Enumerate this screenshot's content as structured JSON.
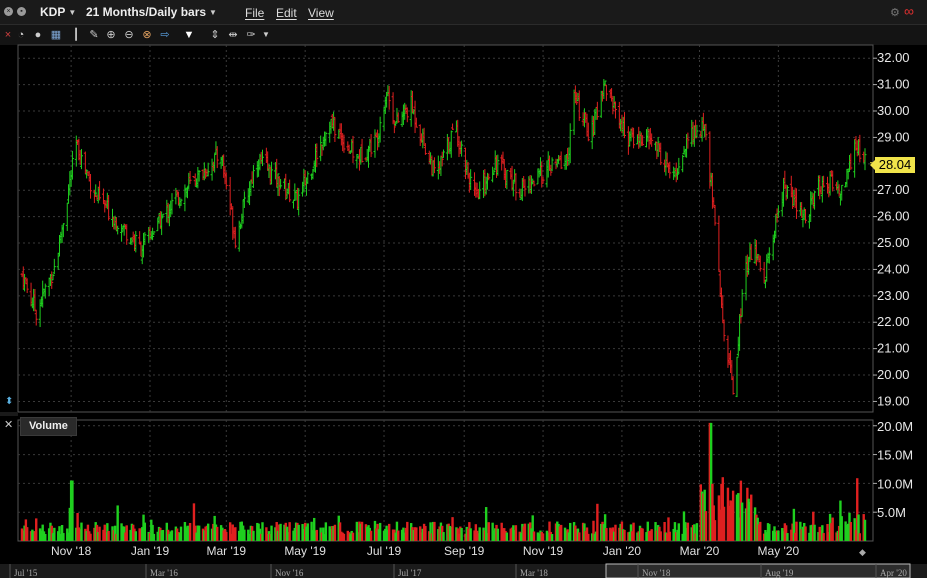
{
  "window": {
    "symbol": "KDP",
    "period": "21 Months/Daily bars",
    "menus": [
      "File",
      "Edit",
      "View"
    ]
  },
  "toolbar": {
    "tools": [
      "close-icon",
      "clock-icon",
      "circle-icon",
      "grid-icon",
      "bars-icon",
      "draw-icon",
      "zoom-in-icon",
      "zoom-out-icon",
      "crosshair-icon",
      "arrow-icon",
      "triangle-down-icon",
      "move-icon",
      "split-icon",
      "wrench-icon",
      "dropdown-icon"
    ]
  },
  "price_axis": {
    "labels": [
      "32.00",
      "31.00",
      "30.00",
      "29.00",
      "28.00",
      "27.00",
      "26.00",
      "25.00",
      "24.00",
      "23.00",
      "22.00",
      "21.00",
      "20.00",
      "19.00"
    ],
    "last_price": "28.04"
  },
  "volume_panel": {
    "title": "Volume",
    "labels": [
      "20.0M",
      "15.0M",
      "10.0M",
      "5.0M"
    ]
  },
  "time_axis": {
    "labels": [
      "Nov '18",
      "Jan '19",
      "Mar '19",
      "May '19",
      "Jul '19",
      "Sep '19",
      "Nov '19",
      "Jan '20",
      "Mar '20",
      "May '20"
    ]
  },
  "overview_axis": {
    "labels": [
      "Jul '15",
      "Mar '16",
      "Nov '16",
      "Jul '17",
      "Mar '18",
      "Nov '18",
      "Aug '19",
      "Apr '20"
    ]
  },
  "colors": {
    "up": "#1fd01f",
    "down": "#e02020",
    "grid": "#3a3a3a",
    "price_tag": "#f0e44a"
  },
  "chart_data": {
    "type": "candlestick",
    "y_range": [
      18.6,
      32.5
    ],
    "volume_range": [
      0,
      21
    ],
    "x_start": "2018-09-24",
    "x_end": "2020-07-07",
    "last_price": 28.04,
    "key_points": [
      {
        "date": "2018-09-24",
        "close": 23.8
      },
      {
        "date": "2018-10-05",
        "close": 22.4
      },
      {
        "date": "2018-10-20",
        "close": 24.2
      },
      {
        "date": "2018-11-05",
        "close": 28.7
      },
      {
        "date": "2018-11-20",
        "close": 26.8
      },
      {
        "date": "2018-12-25",
        "close": 24.8
      },
      {
        "date": "2019-01-20",
        "close": 26.6
      },
      {
        "date": "2019-02-25",
        "close": 28.4
      },
      {
        "date": "2019-03-08",
        "close": 25.2
      },
      {
        "date": "2019-03-25",
        "close": 28.2
      },
      {
        "date": "2019-04-25",
        "close": 26.6
      },
      {
        "date": "2019-05-20",
        "close": 29.6
      },
      {
        "date": "2019-06-10",
        "close": 28.2
      },
      {
        "date": "2019-06-25",
        "close": 28.9
      },
      {
        "date": "2019-07-03",
        "close": 30.8
      },
      {
        "date": "2019-07-10",
        "close": 29.5
      },
      {
        "date": "2019-07-22",
        "close": 30.2
      },
      {
        "date": "2019-08-10",
        "close": 27.5
      },
      {
        "date": "2019-08-25",
        "close": 29.4
      },
      {
        "date": "2019-09-10",
        "close": 26.6
      },
      {
        "date": "2019-09-25",
        "close": 28.1
      },
      {
        "date": "2019-10-15",
        "close": 27.0
      },
      {
        "date": "2019-11-05",
        "close": 27.8
      },
      {
        "date": "2019-11-20",
        "close": 28.2
      },
      {
        "date": "2019-11-25",
        "close": 30.5
      },
      {
        "date": "2019-12-08",
        "close": 29.0
      },
      {
        "date": "2019-12-18",
        "close": 31.1
      },
      {
        "date": "2020-01-05",
        "close": 29.0
      },
      {
        "date": "2020-01-25",
        "close": 28.9
      },
      {
        "date": "2020-02-10",
        "close": 27.4
      },
      {
        "date": "2020-02-22",
        "close": 29.1
      },
      {
        "date": "2020-03-05",
        "close": 29.3
      },
      {
        "date": "2020-03-10",
        "close": 27.2
      },
      {
        "date": "2020-03-20",
        "close": 21.6
      },
      {
        "date": "2020-03-27",
        "close": 19.6
      },
      {
        "date": "2020-04-05",
        "close": 23.8
      },
      {
        "date": "2020-04-12",
        "close": 24.9
      },
      {
        "date": "2020-04-20",
        "close": 23.6
      },
      {
        "date": "2020-05-05",
        "close": 27.2
      },
      {
        "date": "2020-05-20",
        "close": 25.9
      },
      {
        "date": "2020-06-05",
        "close": 27.4
      },
      {
        "date": "2020-06-20",
        "close": 27.0
      },
      {
        "date": "2020-07-01",
        "close": 28.8
      },
      {
        "date": "2020-07-07",
        "close": 28.04
      }
    ]
  }
}
